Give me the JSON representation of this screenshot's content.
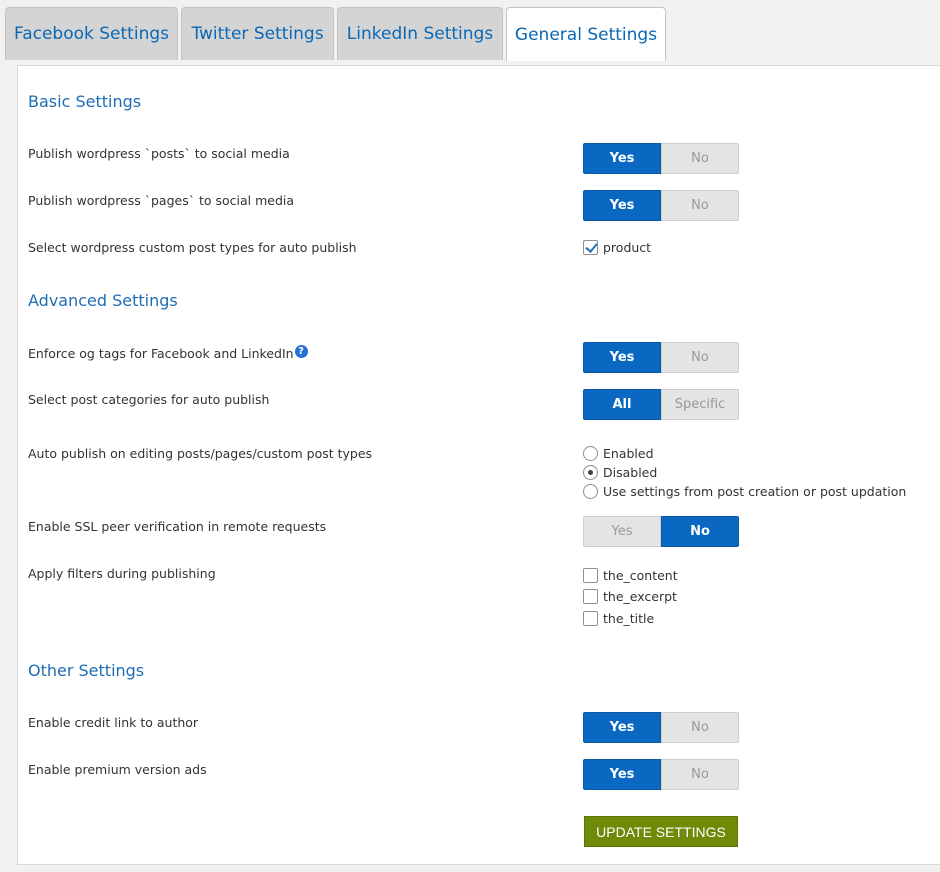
{
  "tabs": [
    {
      "label": "Facebook Settings"
    },
    {
      "label": "Twitter Settings"
    },
    {
      "label": "LinkedIn Settings"
    },
    {
      "label": "General Settings",
      "active": true
    }
  ],
  "basic": {
    "title": "Basic Settings",
    "publish_posts": {
      "label": "Publish wordpress `posts` to social media",
      "yes": "Yes",
      "no": "No",
      "value": "Yes"
    },
    "publish_pages": {
      "label": "Publish wordpress `pages` to social media",
      "yes": "Yes",
      "no": "No",
      "value": "Yes"
    },
    "custom_post_types": {
      "label": "Select wordpress custom post types for auto publish",
      "options": [
        {
          "label": "product",
          "checked": true
        }
      ]
    }
  },
  "advanced": {
    "title": "Advanced Settings",
    "enforce_og": {
      "label": "Enforce og tags for Facebook and LinkedIn",
      "help_icon": "?",
      "yes": "Yes",
      "no": "No",
      "value": "Yes"
    },
    "categories": {
      "label": "Select post categories for auto publish",
      "all": "All",
      "specific": "Specific",
      "value": "All"
    },
    "auto_publish_edit": {
      "label": "Auto publish on editing posts/pages/custom post types",
      "options": [
        {
          "label": "Enabled",
          "checked": false
        },
        {
          "label": "Disabled",
          "checked": true
        },
        {
          "label": "Use settings from post creation or post updation",
          "checked": false
        }
      ]
    },
    "ssl": {
      "label": "Enable SSL peer verification in remote requests",
      "yes": "Yes",
      "no": "No",
      "value": "No"
    },
    "filters": {
      "label": "Apply filters during publishing",
      "options": [
        {
          "label": "the_content",
          "checked": false
        },
        {
          "label": "the_excerpt",
          "checked": false
        },
        {
          "label": "the_title",
          "checked": false
        }
      ]
    }
  },
  "other": {
    "title": "Other Settings",
    "credit_link": {
      "label": "Enable credit link to author",
      "yes": "Yes",
      "no": "No",
      "value": "Yes"
    },
    "premium_ads": {
      "label": "Enable premium version ads",
      "yes": "Yes",
      "no": "No",
      "value": "Yes"
    }
  },
  "update_button": "UPDATE SETTINGS",
  "colors": {
    "accent": "#0a68c2",
    "tab_text": "#0a68b4",
    "section_title": "#1f6cb5",
    "update_button": "#6f8a09"
  }
}
